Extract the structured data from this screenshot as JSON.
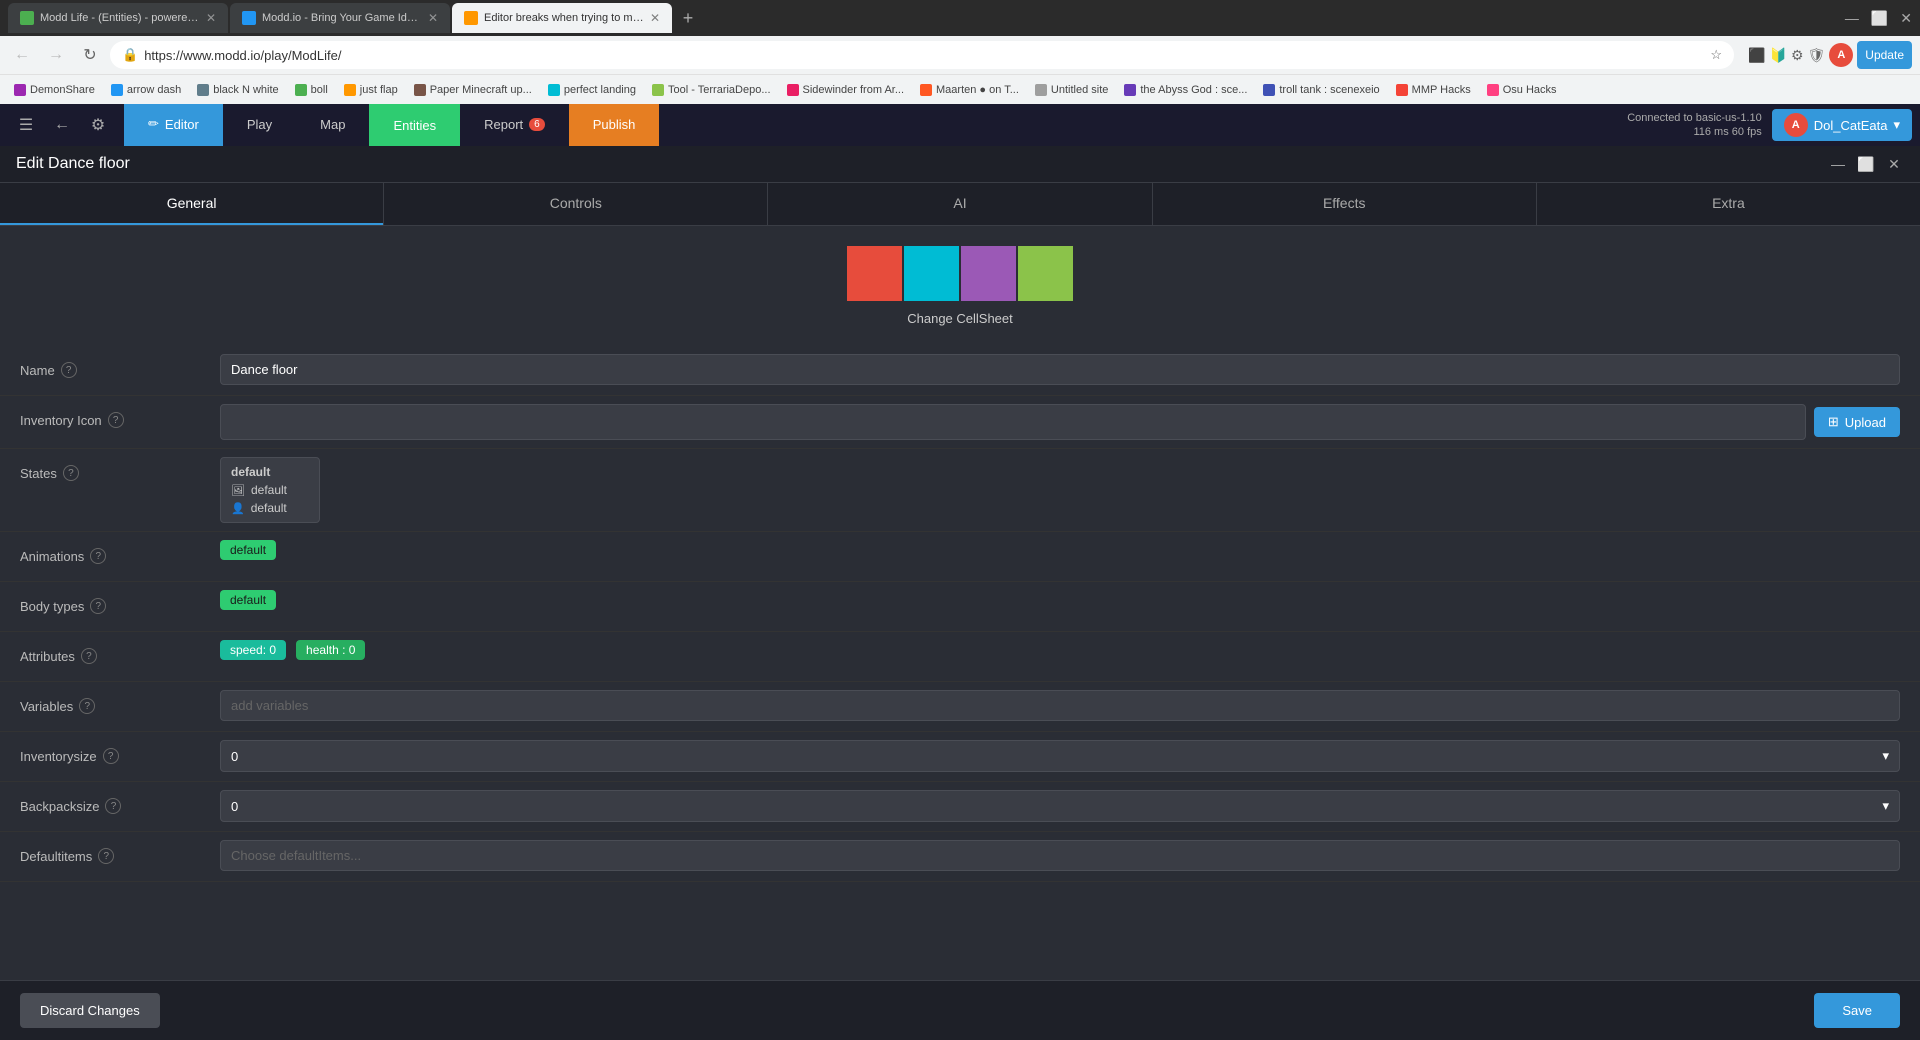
{
  "browser": {
    "tabs": [
      {
        "id": 1,
        "title": "Modd Life - (Entities) - powered...",
        "active": false,
        "favicon_color": "#4CAF50"
      },
      {
        "id": 2,
        "title": "Modd.io - Bring Your Game Idea...",
        "active": false,
        "favicon_color": "#2196F3"
      },
      {
        "id": 3,
        "title": "Editor breaks when trying to ma...",
        "active": true,
        "favicon_color": "#FF9800"
      }
    ],
    "url": "https://www.modd.io/play/ModLife/",
    "bookmarks": [
      "DemonShare",
      "arrow dash",
      "black N white",
      "boll",
      "just flap",
      "Paper Minecraft up...",
      "perfect landing",
      "Tool - TerrariaDepo...",
      "Sidewinder from Ar...",
      "Maarten ● on T...",
      "Untitled site",
      "the Abyss God : sce...",
      "troll tank : scenexeio",
      "MMP Hacks",
      "Osu Hacks"
    ]
  },
  "app": {
    "header": {
      "nav_tabs": [
        {
          "label": "Editor",
          "type": "editor"
        },
        {
          "label": "Play",
          "type": "normal"
        },
        {
          "label": "Map",
          "type": "normal"
        },
        {
          "label": "Entities",
          "type": "active"
        },
        {
          "label": "Report",
          "type": "normal",
          "badge": "6"
        },
        {
          "label": "Publish",
          "type": "publish"
        }
      ],
      "connection": "Connected to basic-us-1.10",
      "fps": "116 ms 60 fps",
      "user": "Dol_CatEata",
      "update_btn": "Update"
    }
  },
  "panel": {
    "title": "Edit Dance floor",
    "tabs": [
      "General",
      "Controls",
      "AI",
      "Effects",
      "Extra"
    ],
    "active_tab": "General",
    "sprite": {
      "colors": [
        "#e74c3c",
        "#00bcd4",
        "#9b59b6",
        "#8bc34a"
      ],
      "change_label": "Change CellSheet"
    },
    "fields": {
      "name": {
        "label": "Name",
        "value": "Dance floor",
        "placeholder": ""
      },
      "inventory_icon": {
        "label": "Inventory Icon",
        "value": "",
        "upload_btn": "Upload"
      },
      "states": {
        "label": "States",
        "items": [
          {
            "text": "default",
            "type": "header"
          },
          {
            "icon": "🖼",
            "text": "default"
          },
          {
            "icon": "👤",
            "text": "default"
          }
        ]
      },
      "animations": {
        "label": "Animations",
        "value": "default"
      },
      "body_types": {
        "label": "Body types",
        "value": "default"
      },
      "attributes": {
        "label": "Attributes",
        "tags": [
          {
            "label": "speed: 0",
            "color": "cyan"
          },
          {
            "label": "health : 0",
            "color": "green"
          }
        ]
      },
      "variables": {
        "label": "Variables",
        "placeholder": "add variables"
      },
      "inventory_size": {
        "label": "Inventorysize",
        "value": "0"
      },
      "backpack_size": {
        "label": "Backpacksize",
        "value": "0"
      },
      "default_items": {
        "label": "Defaultitems",
        "placeholder": "Choose defaultItems..."
      }
    },
    "buttons": {
      "discard": "Discard Changes",
      "save": "Save"
    }
  }
}
